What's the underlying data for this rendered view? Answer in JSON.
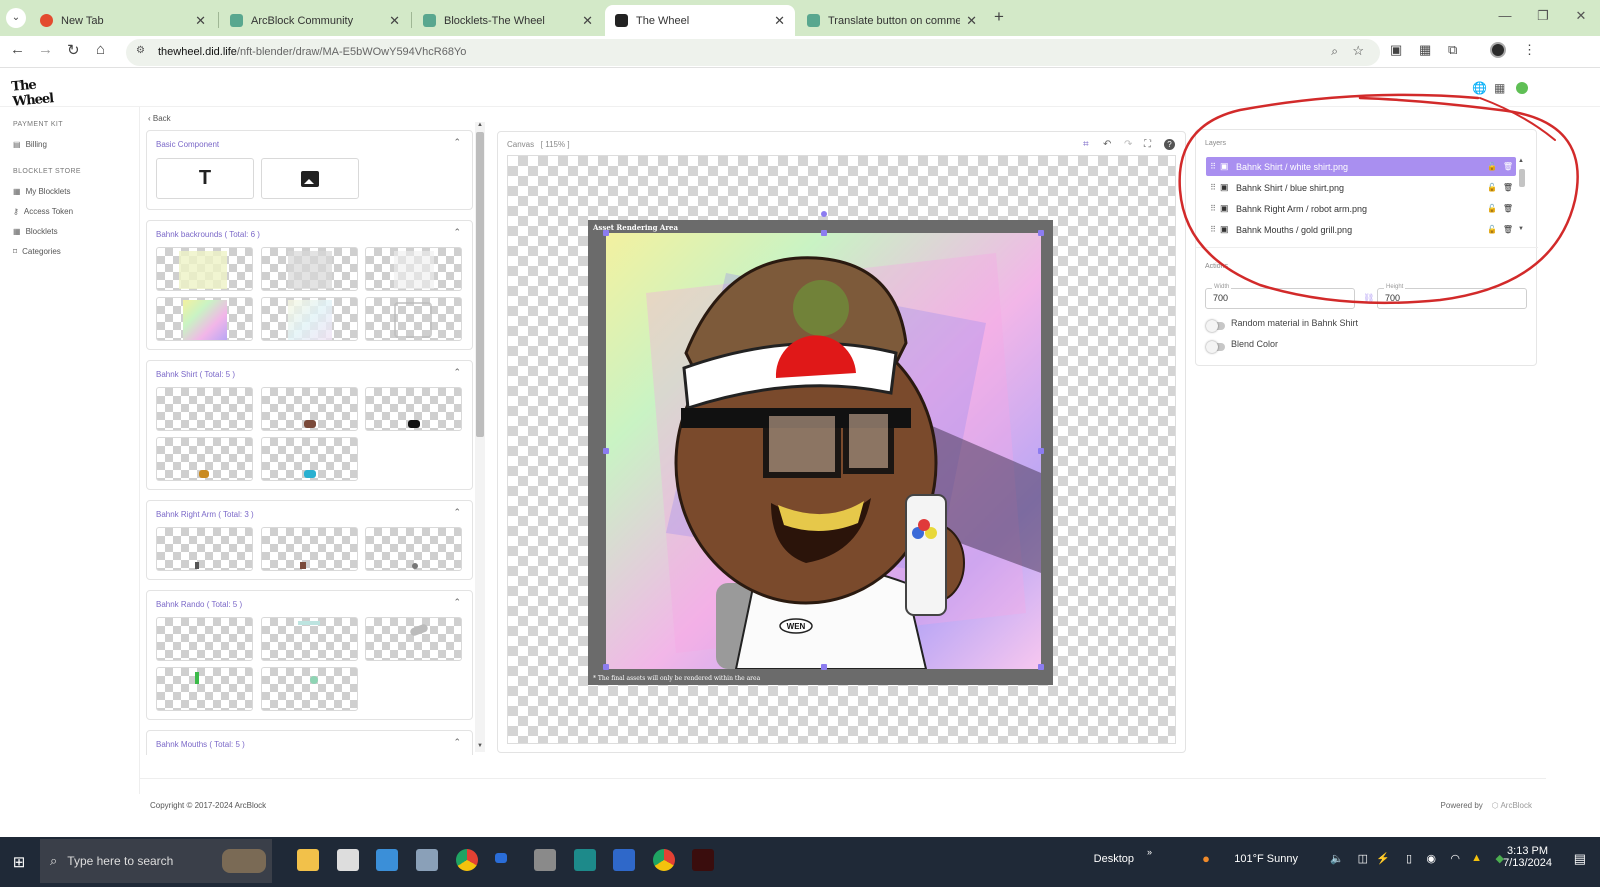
{
  "browser": {
    "tabs": [
      {
        "title": "New Tab",
        "favicon_color": "#e34b2f",
        "active": false
      },
      {
        "title": "ArcBlock Community",
        "favicon_color": "#59a78f",
        "active": false
      },
      {
        "title": "Blocklets-The Wheel",
        "favicon_color": "#59a78f",
        "active": false
      },
      {
        "title": "The Wheel",
        "favicon_color": "#222222",
        "active": true
      },
      {
        "title": "Translate button on comments",
        "favicon_color": "#59a78f",
        "active": false
      }
    ],
    "url_host": "thewheel.did.life",
    "url_path": "/nft-blender/draw/MA-E5bWOwY594VhcR68Yo"
  },
  "app": {
    "logo_text": "TheWheel"
  },
  "sidebar": {
    "sections": [
      {
        "title": "PAYMENT KIT",
        "items": [
          {
            "label": "Billing",
            "icon": "billing-icon"
          }
        ]
      },
      {
        "title": "BLOCKLET STORE",
        "items": [
          {
            "label": "My Blocklets",
            "icon": "grid-icon"
          },
          {
            "label": "Access Token",
            "icon": "key-icon"
          },
          {
            "label": "Blocklets",
            "icon": "grid-icon"
          },
          {
            "label": "Categories",
            "icon": "tag-icon"
          }
        ]
      }
    ]
  },
  "components": {
    "back_label": "Back",
    "groups": [
      {
        "title": "Basic Component"
      },
      {
        "title": "Bahnk backrounds ( Total: 6 )"
      },
      {
        "title": "Bahnk Shirt ( Total: 5 )"
      },
      {
        "title": "Bahnk Right Arm ( Total: 3 )"
      },
      {
        "title": "Bahnk Rando ( Total: 5 )"
      },
      {
        "title": "Bahnk Mouths ( Total: 5 )"
      }
    ],
    "basic_tools": [
      {
        "icon": "text-tool-icon",
        "glyph": "T"
      },
      {
        "icon": "image-tool-icon",
        "glyph": "🖼"
      }
    ]
  },
  "canvas": {
    "label": "Canvas",
    "zoom": "[ 115% ]",
    "area_title": "Asset Rendering Area",
    "area_note": "* The final assets will only be rendered within the area",
    "badge_text": "WEN"
  },
  "layers": {
    "title": "Layers",
    "items": [
      {
        "name": "Bahnk Shirt / white shirt.png",
        "selected": true
      },
      {
        "name": "Bahnk Shirt / blue shirt.png",
        "selected": false
      },
      {
        "name": "Bahnk Right Arm / robot arm.png",
        "selected": false
      },
      {
        "name": "Bahnk Mouths / gold grill.png",
        "selected": false
      }
    ]
  },
  "actions": {
    "title": "Actions",
    "width_label": "Width",
    "width_value": "700",
    "height_label": "Height",
    "height_value": "700",
    "toggles": [
      {
        "label": "Random material in Bahnk Shirt",
        "on": false
      },
      {
        "label": "Blend Color",
        "on": false
      }
    ]
  },
  "footer": {
    "copyright": "Copyright © 2017-2024  ArcBlock",
    "powered_by": "Powered by",
    "powered_brand": "ArcBlock"
  },
  "taskbar": {
    "search_placeholder": "Type here to search",
    "desktop_label": "Desktop",
    "weather": "101°F  Sunny",
    "time": "3:13 PM",
    "date": "7/13/2024"
  },
  "colors": {
    "accent": "#7b68c8",
    "selected_layer": "#a98ff0",
    "annotation_circle": "#d22a2a",
    "tab_strip": "#d3e9c8"
  }
}
